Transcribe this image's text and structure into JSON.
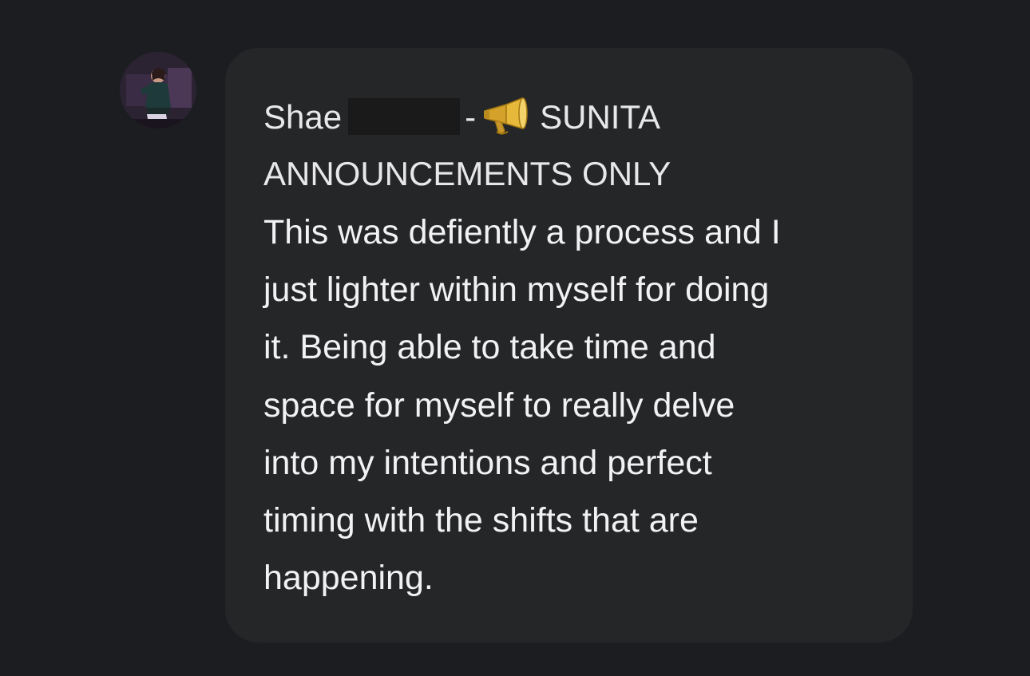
{
  "message": {
    "sender_first_name": "Shae",
    "separator": "-",
    "channel_icon": "megaphone-icon",
    "channel_line1": "SUNITA",
    "channel_line2": "ANNOUNCEMENTS ONLY",
    "body_lines": [
      "This was defiently a process and I",
      "just lighter within myself for doing",
      "it. Being able to take time and",
      "space for myself to really delve",
      "into my intentions and perfect",
      "timing with the shifts that are",
      "happening."
    ]
  },
  "colors": {
    "background": "#1c1d20",
    "bubble": "#252628",
    "text": "#f2f2f4",
    "redaction": "#1a1a1a"
  }
}
